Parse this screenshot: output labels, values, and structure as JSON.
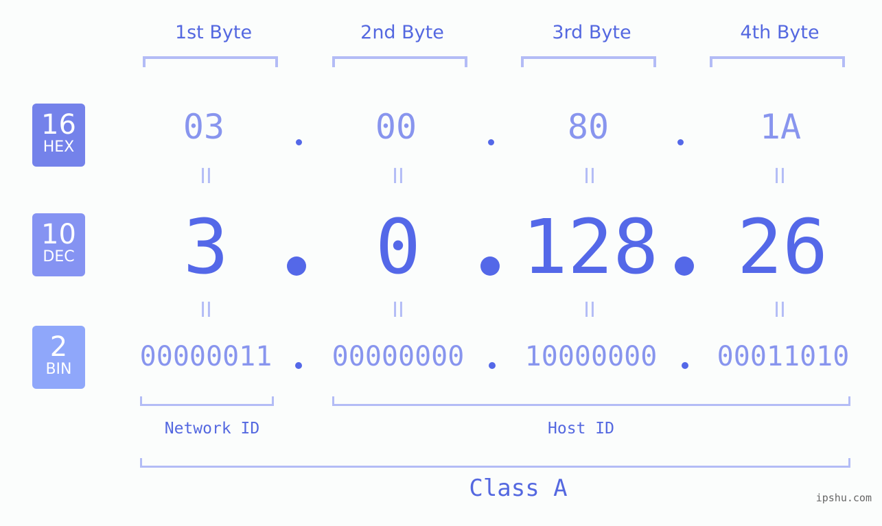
{
  "bytes": {
    "labels": [
      "1st Byte",
      "2nd Byte",
      "3rd Byte",
      "4th Byte"
    ]
  },
  "badges": {
    "hex": {
      "number": "16",
      "label": "HEX",
      "color": "#7482ea"
    },
    "dec": {
      "number": "10",
      "label": "DEC",
      "color": "#8593f2"
    },
    "bin": {
      "number": "2",
      "label": "BIN",
      "color": "#8fa7fa"
    }
  },
  "hex_values": [
    "03",
    "00",
    "80",
    "1A"
  ],
  "dec_values": [
    "3",
    "0",
    "128",
    "26"
  ],
  "bin_values": [
    "00000011",
    "00000000",
    "10000000",
    "00011010"
  ],
  "separator": ".",
  "equals": "II",
  "network_id_label": "Network ID",
  "host_id_label": "Host ID",
  "class_label": "Class A",
  "watermark": "ipshu.com",
  "colors": {
    "primary": "#5468e8",
    "light": "#8895ee",
    "bracket": "#b3bcf6"
  }
}
